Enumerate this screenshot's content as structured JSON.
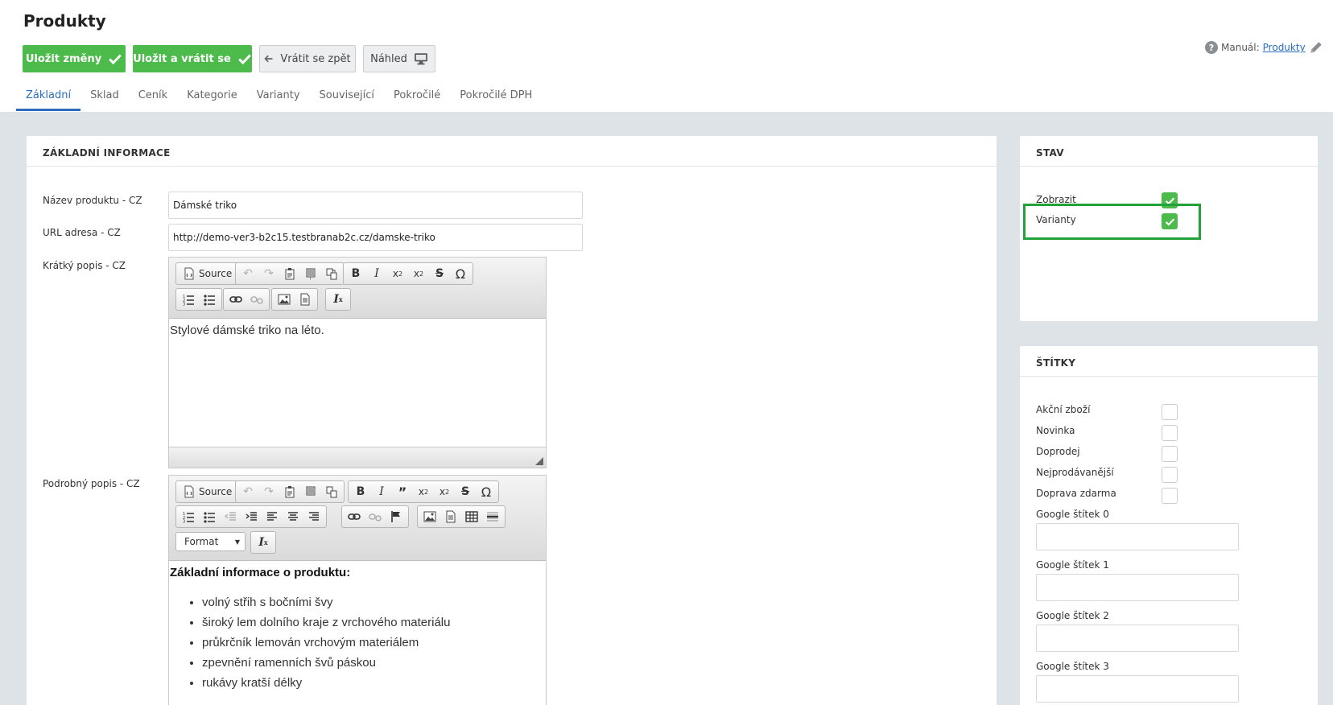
{
  "page": {
    "title": "Produkty"
  },
  "toolbar": {
    "save_label": "Uložit změny",
    "save_return_label": "Uložit a vrátit se",
    "back_label": "Vrátit se zpět",
    "preview_label": "Náhled"
  },
  "manual": {
    "prefix": "Manuál:",
    "link": "Produkty"
  },
  "tabs": [
    "Základní",
    "Sklad",
    "Ceník",
    "Kategorie",
    "Varianty",
    "Související",
    "Pokročilé",
    "Pokročilé DPH"
  ],
  "main": {
    "section_title": "ZÁKLADNÍ INFORMACE",
    "name_label": "Název produktu - CZ",
    "name_value": "Dámské triko",
    "url_label": "URL adresa - CZ",
    "url_value": "http://demo-ver3-b2c15.testbranab2c.cz/damske-triko",
    "short_label": "Krátký popis - CZ",
    "short_text": "Stylové dámské triko na léto.",
    "long_label": "Podrobný popis - CZ",
    "long_heading": "Základní informace o produktu:",
    "long_items": [
      "volný střih s bočními švy",
      "široký lem dolního kraje z vrchového materiálu",
      "průkrčník lemován vrchovým materiálem",
      "zpevnění ramenních švů páskou",
      "rukávy kratší délky"
    ]
  },
  "editor": {
    "source_label": "Source",
    "format_label": "Format"
  },
  "stav": {
    "title": "STAV",
    "items": [
      {
        "label": "Zobrazit",
        "checked": true
      },
      {
        "label": "Varianty",
        "checked": true
      }
    ]
  },
  "stitky": {
    "title": "ŠTÍTKY",
    "checkboxes": [
      {
        "label": "Akční zboží",
        "checked": false
      },
      {
        "label": "Novinka",
        "checked": false
      },
      {
        "label": "Doprodej",
        "checked": false
      },
      {
        "label": "Nejprodávanější",
        "checked": false
      },
      {
        "label": "Doprava zdarma",
        "checked": false
      }
    ],
    "google_labels": [
      "Google štítek 0",
      "Google štítek 1",
      "Google štítek 2",
      "Google štítek 3"
    ]
  },
  "colors": {
    "accent": "#2a6cc0",
    "green": "#4cbb4c",
    "highlight": "#22a33a",
    "background": "#dde3e6"
  }
}
